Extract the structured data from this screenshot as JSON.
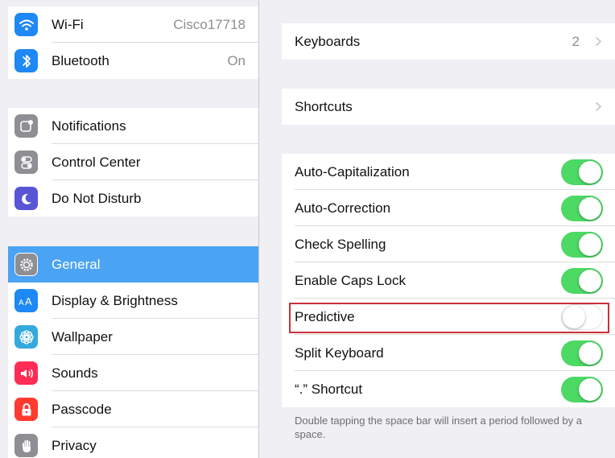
{
  "sidebar": {
    "items": [
      {
        "label": "Wi-Fi",
        "value": "Cisco17718",
        "icon": "wifi-icon",
        "color": "#1e88f5"
      },
      {
        "label": "Bluetooth",
        "value": "On",
        "icon": "bluetooth-icon",
        "color": "#1e88f5"
      },
      {
        "label": "Notifications",
        "value": "",
        "icon": "notifications-icon",
        "color": "#8e8e93"
      },
      {
        "label": "Control Center",
        "value": "",
        "icon": "control-center-icon",
        "color": "#8e8e93"
      },
      {
        "label": "Do Not Disturb",
        "value": "",
        "icon": "moon-icon",
        "color": "#5856d6"
      },
      {
        "label": "General",
        "value": "",
        "icon": "gear-icon",
        "color": "#8e8e93",
        "selected": true
      },
      {
        "label": "Display & Brightness",
        "value": "",
        "icon": "display-icon",
        "color": "#1e88f5"
      },
      {
        "label": "Wallpaper",
        "value": "",
        "icon": "wallpaper-icon",
        "color": "#34aadc"
      },
      {
        "label": "Sounds",
        "value": "",
        "icon": "sounds-icon",
        "color": "#ff2d55"
      },
      {
        "label": "Passcode",
        "value": "",
        "icon": "lock-icon",
        "color": "#ff3b30"
      },
      {
        "label": "Privacy",
        "value": "",
        "icon": "hand-icon",
        "color": "#8e8e93"
      }
    ],
    "selected_color": "#4aa3f3"
  },
  "main": {
    "keyboards": {
      "label": "Keyboards",
      "value": "2"
    },
    "shortcuts": {
      "label": "Shortcuts"
    },
    "toggles": [
      {
        "label": "Auto-Capitalization",
        "on": true
      },
      {
        "label": "Auto-Correction",
        "on": true
      },
      {
        "label": "Check Spelling",
        "on": true
      },
      {
        "label": "Enable Caps Lock",
        "on": true
      },
      {
        "label": "Predictive",
        "on": false,
        "highlighted": true
      },
      {
        "label": "Split Keyboard",
        "on": true
      },
      {
        "label": "“.” Shortcut",
        "on": true
      }
    ],
    "footer_note": "Double tapping the space bar will insert a period followed by a space.",
    "toggle_on_color": "#4cd964",
    "highlight_color": "#c9313a"
  }
}
